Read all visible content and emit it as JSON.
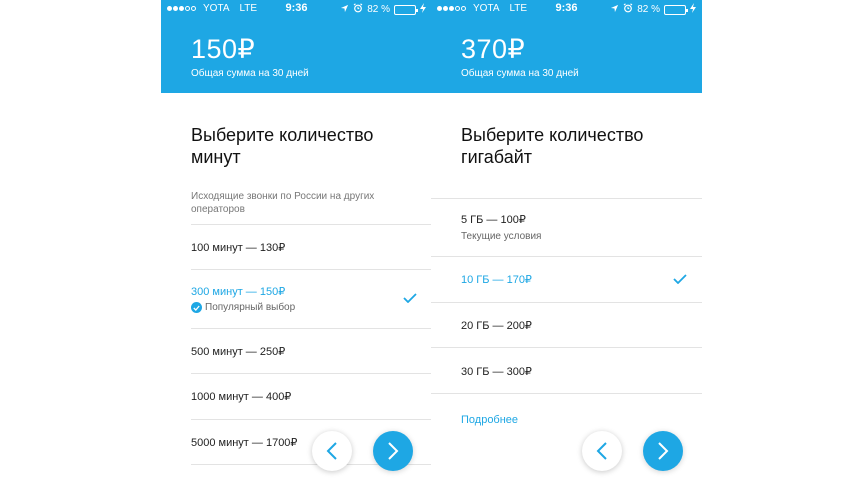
{
  "status_bar": {
    "carrier": "YOTA",
    "network": "LTE",
    "time": "9:36",
    "battery": "82 %",
    "battery_level": 0.82
  },
  "colors": {
    "accent": "#1ea7e4",
    "battery": "#4cd964"
  },
  "minutes_screen": {
    "total_price": "150₽",
    "total_caption": "Общая сумма на 30 дней",
    "title": "Выберите количество минут",
    "subtitle": "Исходящие звонки по России на других операторов",
    "options": [
      {
        "label": "100 минут — 130₽"
      },
      {
        "label": "300 минут — 150₽",
        "badge": "Популярный выбор",
        "selected": true
      },
      {
        "label": "500 минут — 250₽"
      },
      {
        "label": "1000 минут — 400₽"
      },
      {
        "label": "5000 минут — 1700₽"
      }
    ]
  },
  "data_screen": {
    "total_price": "370₽",
    "total_caption": "Общая сумма на 30 дней",
    "title": "Выберите количество гигабайт",
    "options": [
      {
        "label": "5 ГБ — 100₽",
        "note": "Текущие условия"
      },
      {
        "label": "10 ГБ — 170₽",
        "selected": true
      },
      {
        "label": "20 ГБ — 200₽"
      },
      {
        "label": "30 ГБ — 300₽"
      }
    ],
    "more_link": "Подробнее"
  },
  "icons": {
    "back": "chevron-left-icon",
    "forward": "chevron-right-icon",
    "selected": "checkmark-icon",
    "badge": "checkmark-circle-icon",
    "location": "location-arrow-icon",
    "alarm": "alarm-clock-icon",
    "charging": "charging-bolt-icon"
  }
}
